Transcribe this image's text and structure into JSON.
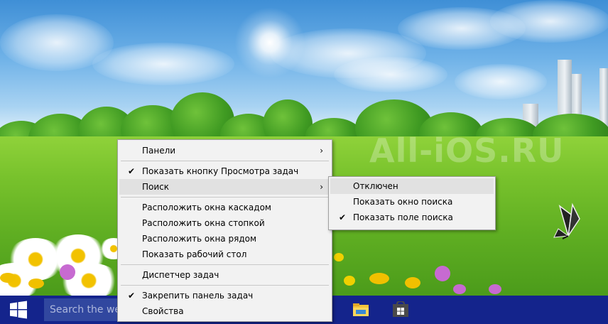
{
  "wallpaper": {
    "watermark_text": "All-iOS.RU"
  },
  "taskbar": {
    "search_placeholder": "Search the web",
    "color": "#14248c"
  },
  "context_menu": {
    "items": [
      {
        "label": "Панели",
        "checked": false,
        "submenu": true
      },
      {
        "label": "Показать кнопку Просмотра задач",
        "checked": true,
        "submenu": false
      },
      {
        "label": "Поиск",
        "checked": false,
        "submenu": true,
        "highlighted": true
      },
      {
        "label": "Расположить окна каскадом",
        "checked": false,
        "submenu": false
      },
      {
        "label": "Расположить окна стопкой",
        "checked": false,
        "submenu": false
      },
      {
        "label": "Расположить окна рядом",
        "checked": false,
        "submenu": false
      },
      {
        "label": "Показать рабочий стол",
        "checked": false,
        "submenu": false
      },
      {
        "label": "Диспетчер задач",
        "checked": false,
        "submenu": false
      },
      {
        "label": "Закрепить панель задач",
        "checked": true,
        "submenu": false
      },
      {
        "label": "Свойства",
        "checked": false,
        "submenu": false
      }
    ],
    "check_glyph": "✔",
    "arrow_glyph": "›"
  },
  "search_submenu": {
    "items": [
      {
        "label": "Отключен",
        "checked": false,
        "highlighted": true
      },
      {
        "label": "Показать окно поиска",
        "checked": false
      },
      {
        "label": "Показать поле поиска",
        "checked": true
      }
    ]
  }
}
